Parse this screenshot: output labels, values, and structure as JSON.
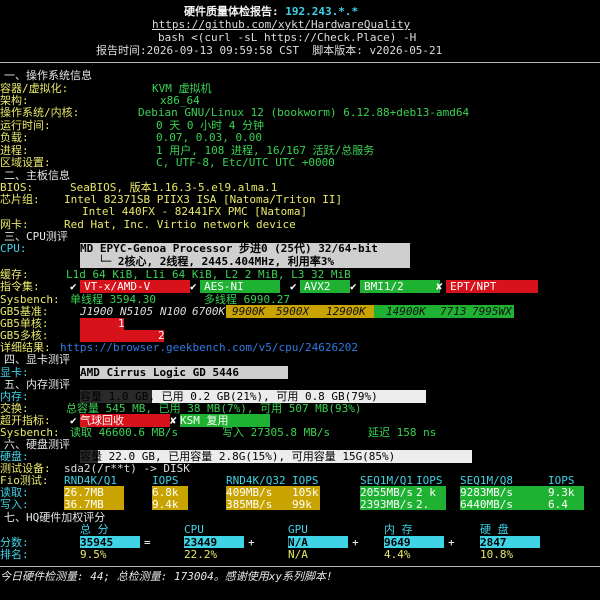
{
  "header": {
    "title_prefix": "硬件质量体检报告:",
    "ip": "192.243.*.*",
    "url": "https://github.com/xykt/HardwareQuality",
    "cmd": "bash <(curl -sL https://Check.Place) -H",
    "time_label": "报告时间:",
    "time_value": "2026-09-13 09:59:58 CST",
    "ver_label": "脚本版本:",
    "ver_value": "v2026-05-21"
  },
  "os": {
    "section": "一、操作系统信息",
    "rows": [
      {
        "label": "容器/虚拟化:",
        "value": "KVM 虚拟机"
      },
      {
        "label": "架构:",
        "value": "x86_64"
      },
      {
        "label": "操作系统/内核:",
        "value": "Debian GNU/Linux 12 (bookworm) 6.12.88+deb13-amd64"
      },
      {
        "label": "运行时间:",
        "value": "0 天 0 小时 4 分钟"
      },
      {
        "label": "负载:",
        "value": "0.07, 0.03, 0.00"
      },
      {
        "label": "进程:",
        "value": "1 用户, 108 进程, 16/167 活跃/总服务"
      },
      {
        "label": "区域设置:",
        "value": "C, UTF-8, Etc/UTC UTC +0000"
      }
    ]
  },
  "board": {
    "section": "二、主板信息",
    "bios_label": "BIOS:",
    "bios_value": "SeaBIOS, 版本1.16.3-5.el9.alma.1",
    "chip_label": "芯片组:",
    "chip_value1": "Intel 82371SB PIIX3 ISA [Natoma/Triton II]",
    "chip_value2": "Intel 440FX - 82441FX PMC [Natoma]",
    "nic_label": "网卡:",
    "nic_value": "Red Hat, Inc. Virtio network device"
  },
  "cpu": {
    "section": "三、CPU测评",
    "label": "CPU:",
    "model": "MD EPYC-Genoa Processor 步进0 (25代) 32/64-bit",
    "cores": "└─ 2核心, 2线程, 2445.404MHz, 利用率3%",
    "cache_label": "缓存:",
    "cache_value": "L1d 64 KiB, L1i 64 KiB, L2 2 MiB, L3 32 MiB",
    "isa_label": "指令集:",
    "isa": [
      {
        "mark": "✔",
        "name": "VT-x/AMD-V",
        "ok": false
      },
      {
        "mark": "✔",
        "name": "AES-NI",
        "ok": true
      },
      {
        "mark": "✔",
        "name": "AVX2",
        "ok": true
      },
      {
        "mark": "✔",
        "name": "BMI1/2",
        "ok": true
      },
      {
        "mark": "✘",
        "name": "EPT/NPT",
        "ok": false
      }
    ],
    "sysbench_label": "Sysbench:",
    "sysbench_single": "单线程 3594.30",
    "sysbench_multi": "多线程 6990.27",
    "gb5_base_label": "GB5基准:",
    "gb5_base": [
      "J1900",
      "N5105",
      "N100",
      "6700K",
      "9900K",
      "5900X",
      "12900K",
      "14900K",
      "7713",
      "7995WX"
    ],
    "gb5_single_label": "GB5单核:",
    "gb5_single_value": "1",
    "gb5_multi_label": "GB5多核:",
    "gb5_multi_value": "2",
    "detail_label": "详细结果:",
    "detail_url": "https://browser.geekbench.com/v5/cpu/24626202"
  },
  "gpu": {
    "section": "四、显卡测评",
    "label": "显卡:",
    "value": "AMD Cirrus Logic GD 5446"
  },
  "mem": {
    "section": "五、内存测评",
    "mem_label": "内存:",
    "mem_value": "容量 1.0 GB, 已用 0.2 GB(21%), 可用 0.8 GB(79%)",
    "swap_label": "交换:",
    "swap_value": "总容量 545 MB, 已用 38 MB(7%), 可用 507 MB(93%)",
    "hyper_label": "超开指标:",
    "hyper_balloon": "气球回收",
    "hyper_ksm": "KSM 复用",
    "sysbench_label": "Sysbench:",
    "sysbench_read": "读取 46600.6 MB/s",
    "sysbench_write": "写入 27305.8 MB/s",
    "sysbench_lat": "延迟 158 ns"
  },
  "disk": {
    "section": "六、硬盘测评",
    "disk_label": "硬盘:",
    "disk_value": "容量 22.0 GB, 已用容量 2.8G(15%), 可用容量 15G(85%)",
    "device_label": "测试设备:",
    "device_value": "sda2(/r**t) -> DISK",
    "fio_label": "Fio测试:",
    "cols": [
      "RND4K/Q1",
      "IOPS",
      "RND4K/Q32",
      "IOPS",
      "SEQ1M/Q1",
      "IOPS",
      "SEQ1M/Q8",
      "IOPS"
    ],
    "read_label": "读取:",
    "read": [
      "26.7MB",
      "6.8k",
      "409MB/s",
      "105k",
      "2055MB/s",
      "2 k",
      "9283MB/s",
      "9.3k"
    ],
    "write_label": "写入:",
    "write": [
      "36.7MB",
      "9.4k",
      "385MB/s",
      "99k",
      "2393MB/s",
      "2.",
      "6440MB/s",
      "6.4"
    ]
  },
  "score": {
    "section": "七、HQ硬件加权评分",
    "cols": [
      "总 分",
      "CPU",
      "GPU",
      "内 存",
      "硬 盘"
    ],
    "score_label": "分数:",
    "scores": [
      "35945",
      "23449",
      "N/A",
      "9649",
      "2847"
    ],
    "plus": [
      "=",
      "+",
      "+",
      "+"
    ],
    "rank_label": "排名:",
    "ranks": [
      "9.5%",
      "22.2%",
      "N/A",
      "4.4%",
      "10.8%"
    ]
  },
  "footer": "今日硬件检测量: 44; 总检测量: 173004。感谢使用xy系列脚本!"
}
